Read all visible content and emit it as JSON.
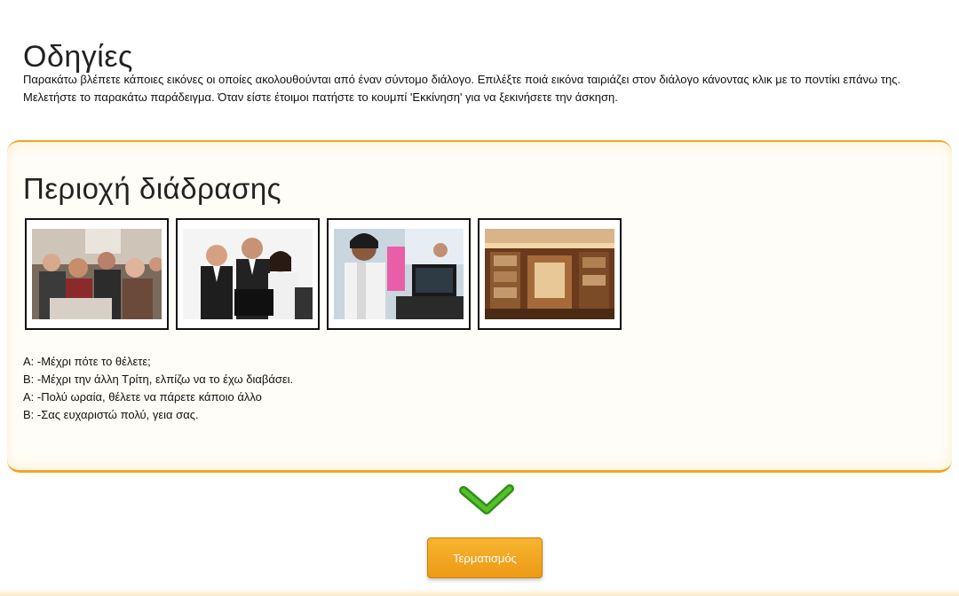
{
  "instructions": {
    "title": "Οδηγίες",
    "text": "Παρακάτω βλέπετε κάποιες εικόνες οι οποίες ακολουθούνται από έναν σύντομο διάλογο. Επιλέξτε ποιά εικόνα ταιριάζει στον διάλογο κάνοντας κλικ με το ποντίκι επάνω της. Μελετήστε το παρακάτω παράδειγμα. Όταν είστε έτοιμοι πατήστε το κουμπί 'Εκκίνηση' για να ξεκινήσετε την άσκηση."
  },
  "interaction": {
    "title": "Περιοχή διάδρασης",
    "images": [
      {
        "subject": "group-of-people-photo"
      },
      {
        "subject": "office-team-at-computer-photo"
      },
      {
        "subject": "people-at-computers-photo"
      },
      {
        "subject": "library-interior-photo"
      }
    ],
    "dialogue": [
      "A: -Μέχρι πότε το θέλετε;",
      "B: -Μέχρι την άλλη Τρίτη, ελπίζω να το έχω διαβάσει.",
      "A: -Πολύ ωραία, θέλετε να πάρετε κάποιο άλλο",
      "B: -Σας ευχαριστώ πολύ, γεια σας."
    ]
  },
  "status": {
    "icon": "check-icon",
    "color": "#3a9a1e"
  },
  "finish_button": {
    "label": "Τερματισμός"
  },
  "colors": {
    "accent": "#f2a620",
    "button": "#f2a325"
  }
}
